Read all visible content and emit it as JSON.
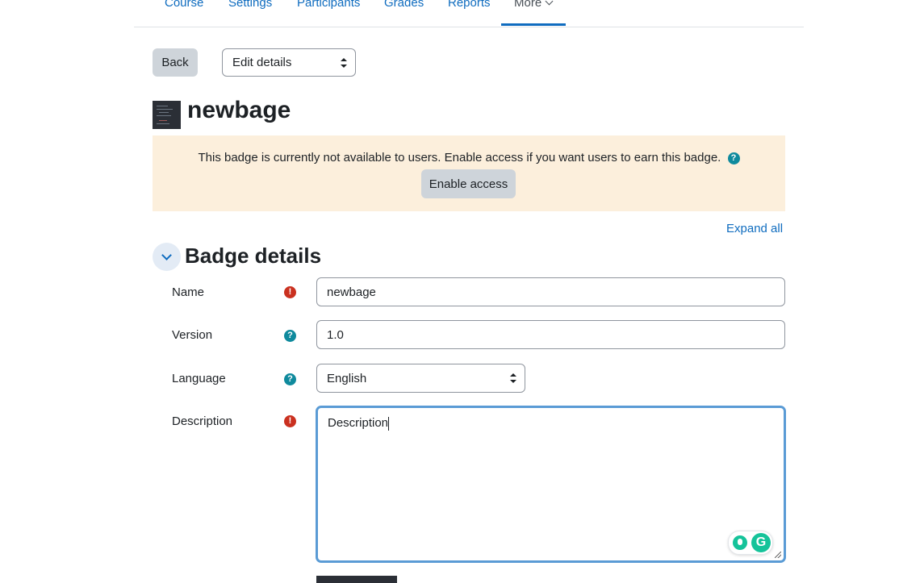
{
  "nav": {
    "tabs": [
      "Course",
      "Settings",
      "Participants",
      "Grades",
      "Reports"
    ],
    "more_label": "More",
    "active_tab": "More"
  },
  "toolbar": {
    "back_label": "Back",
    "action_select_value": "Edit details"
  },
  "badge": {
    "name": "newbage",
    "image_icon": "badge-image"
  },
  "alert": {
    "message": "This badge is currently not available to users. Enable access if you want users to earn this badge.",
    "help_icon": "?",
    "enable_button": "Enable access",
    "background": "#fcefdc"
  },
  "expand_all": "Expand all",
  "section": {
    "title": "Badge details",
    "toggle_icon": "chevron-down-icon"
  },
  "form": {
    "name_label": "Name",
    "name_value": "newbage",
    "version_label": "Version",
    "version_value": "1.0",
    "language_label": "Language",
    "language_value": "English",
    "description_label": "Description",
    "description_value": "Description",
    "required_icon": "!",
    "help_icon": "?"
  },
  "grammarly": {
    "logo_text": "G"
  },
  "colors": {
    "link": "#0f6cbf",
    "required": "#ca3120",
    "help": "#0f8a9d",
    "focus": "#5a9bd5"
  }
}
